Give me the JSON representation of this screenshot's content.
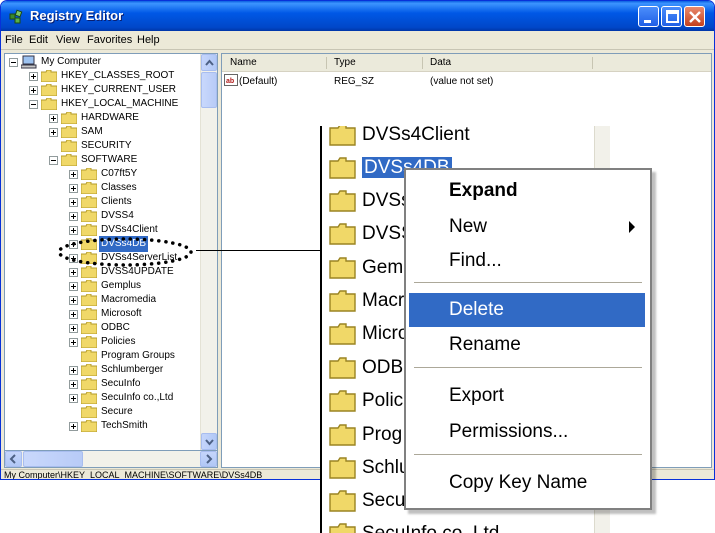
{
  "window": {
    "title": "Registry Editor",
    "accent_color": "#0058e6"
  },
  "menu": [
    "File",
    "Edit",
    "View",
    "Favorites",
    "Help"
  ],
  "tree": {
    "root": "My Computer",
    "hives": [
      "HKEY_CLASSES_ROOT",
      "HKEY_CURRENT_USER",
      "HKEY_LOCAL_MACHINE"
    ],
    "hklm_keys": [
      "HARDWARE",
      "SAM",
      "SECURITY",
      "SOFTWARE"
    ],
    "software_keys": [
      "C07ft5Y",
      "Classes",
      "Clients",
      "DVSS4",
      "DVSs4Client",
      "DVSs4DB",
      "DVSs4ServerList",
      "DVSS4UPDATE",
      "Gemplus",
      "Macromedia",
      "Microsoft",
      "ODBC",
      "Policies",
      "Program Groups",
      "Schlumberger",
      "SecuInfo",
      "SecuInfo co.,Ltd",
      "Secure",
      "TechSmith"
    ],
    "selected": "DVSs4DB"
  },
  "list": {
    "columns": [
      "Name",
      "Type",
      "Data"
    ],
    "rows": [
      {
        "name": "(Default)",
        "type": "REG_SZ",
        "data": "(value not set)"
      }
    ]
  },
  "status": "My Computer\\HKEY_LOCAL_MACHINE\\SOFTWARE\\DVSs4DB",
  "zoom": {
    "rows": [
      "DVSs4Client",
      "DVSs4DB",
      "DVSs",
      "DVSS",
      "Gem",
      "Macr",
      "Micro",
      "ODB",
      "Polic",
      "Prog",
      "Schlu",
      "Secu",
      "SecuInfo co.,Ltd"
    ],
    "selected_index": 1
  },
  "context_menu": {
    "expand": "Expand",
    "new": "New",
    "find": "Find...",
    "delete": "Delete",
    "rename": "Rename",
    "export": "Export",
    "permissions": "Permissions...",
    "copy_key_name": "Copy Key Name"
  }
}
